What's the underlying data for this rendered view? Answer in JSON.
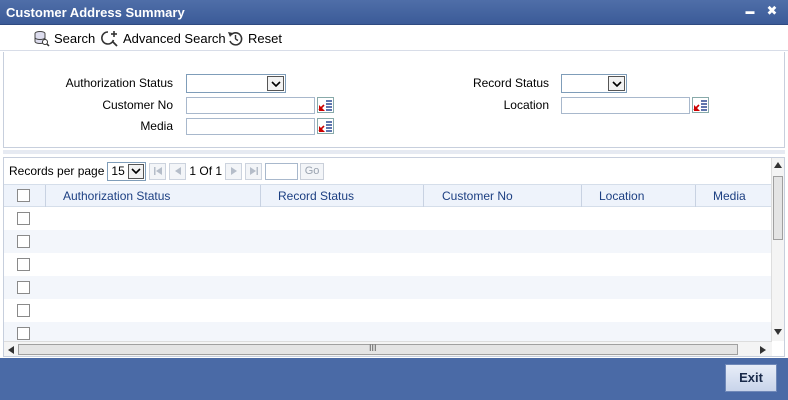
{
  "window": {
    "title": "Customer Address Summary",
    "minimize_glyph": "▬",
    "close_glyph": "✖"
  },
  "toolbar": {
    "search_label": "Search",
    "advanced_search_label": "Advanced Search",
    "reset_label": "Reset"
  },
  "criteria": {
    "authorization_status_label": "Authorization Status",
    "customer_no_label": "Customer No",
    "media_label": "Media",
    "record_status_label": "Record Status",
    "location_label": "Location",
    "authorization_status_value": "",
    "record_status_value": "",
    "customer_no_value": "",
    "media_value": "",
    "location_value": ""
  },
  "pager": {
    "records_per_page_label": "Records per page",
    "records_per_page_value": "15",
    "page_info": "1 Of 1",
    "go_label": "Go"
  },
  "grid": {
    "columns": [
      "Authorization Status",
      "Record Status",
      "Customer No",
      "Location",
      "Media"
    ],
    "row_count": 6
  },
  "hscroll": {
    "grip": "III"
  },
  "footer": {
    "exit_label": "Exit"
  },
  "icons": [
    "search-icon",
    "advanced-search-icon",
    "reset-icon",
    "lov-icon",
    "first-page-icon",
    "prev-page-icon",
    "next-page-icon",
    "last-page-icon"
  ]
}
